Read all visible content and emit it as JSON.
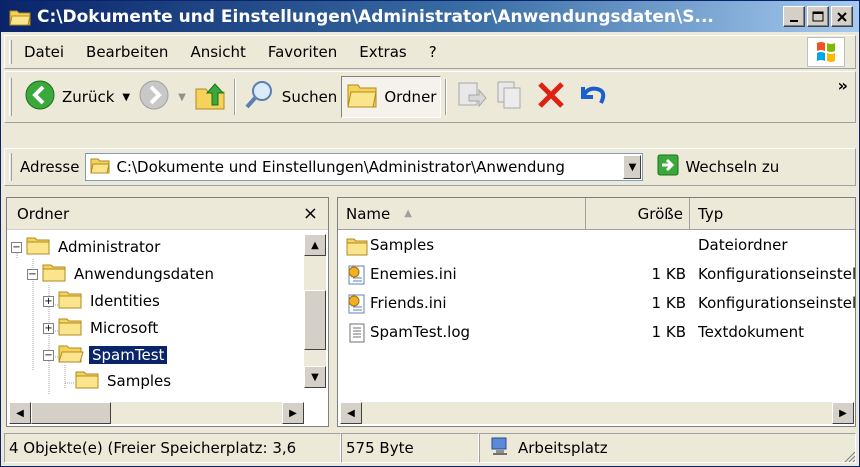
{
  "window": {
    "title": "C:\\Dokumente und Einstellungen\\Administrator\\Anwendungsdaten\\S..."
  },
  "menubar": {
    "items": [
      "Datei",
      "Bearbeiten",
      "Ansicht",
      "Favoriten",
      "Extras",
      "?"
    ]
  },
  "toolbar": {
    "back_label": "Zurück",
    "search_label": "Suchen",
    "folders_label": "Ordner",
    "more": "»"
  },
  "address": {
    "label": "Adresse",
    "value": "C:\\Dokumente und Einstellungen\\Administrator\\Anwendung",
    "go_label": "Wechseln zu"
  },
  "tree": {
    "header": "Ordner",
    "close": "×",
    "nodes": [
      {
        "label": "Administrator",
        "expander": "−",
        "selected": false
      },
      {
        "label": "Anwendungsdaten",
        "expander": "−",
        "selected": false
      },
      {
        "label": "Identities",
        "expander": "+",
        "selected": false
      },
      {
        "label": "Microsoft",
        "expander": "+",
        "selected": false
      },
      {
        "label": "SpamTest",
        "expander": "−",
        "selected": true
      },
      {
        "label": "Samples",
        "expander": "",
        "selected": false
      }
    ]
  },
  "filelist": {
    "columns": [
      "Name",
      "Größe",
      "Typ"
    ],
    "rows": [
      {
        "name": "Samples",
        "size": "",
        "type": "Dateiordner",
        "icon": "folder-icon"
      },
      {
        "name": "Enemies.ini",
        "size": "1 KB",
        "type": "Konfigurationseinstellungen",
        "icon": "ini-file-icon"
      },
      {
        "name": "Friends.ini",
        "size": "1 KB",
        "type": "Konfigurationseinstellungen",
        "icon": "ini-file-icon"
      },
      {
        "name": "SpamTest.log",
        "size": "1 KB",
        "type": "Textdokument",
        "icon": "text-file-icon"
      }
    ]
  },
  "statusbar": {
    "objects": "4 Objekte(e) (Freier Speicherplatz: 3,6",
    "size": "575 Byte",
    "location": "Arbeitsplatz"
  },
  "colors": {
    "titlebar": "#0a246a",
    "selection": "#0a246a",
    "chrome": "#ece9d8",
    "back_green": "#3aa83a",
    "delete_red": "#e02010"
  }
}
